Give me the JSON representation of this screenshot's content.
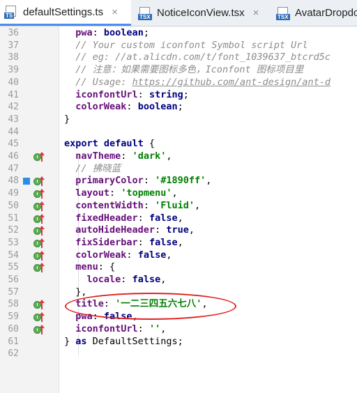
{
  "tabs": [
    {
      "badge": "TS",
      "label": "defaultSettings.ts",
      "active": true
    },
    {
      "badge": "TSX",
      "label": "NoticeIconView.tsx",
      "active": false
    },
    {
      "badge": "TSX",
      "label": "AvatarDropdo",
      "active": false
    }
  ],
  "close_glyph": "×",
  "lines": [
    {
      "n": "36",
      "tokens": [
        {
          "t": "  "
        },
        {
          "t": "pwa",
          "c": "prop"
        },
        {
          "t": ": "
        },
        {
          "t": "boolean",
          "c": "kw"
        },
        {
          "t": ";"
        }
      ]
    },
    {
      "n": "37",
      "tokens": [
        {
          "t": "  // Your custom iconfont Symbol script Url",
          "c": "cmt"
        }
      ]
    },
    {
      "n": "38",
      "tokens": [
        {
          "t": "  // eg: //at.alicdn.com/t/font_1039637_btcrd5c",
          "c": "cmt"
        }
      ]
    },
    {
      "n": "39",
      "tokens": [
        {
          "t": "  // 注意：如果需要图标多色，Iconfont 图标项目里",
          "c": "cmt"
        }
      ]
    },
    {
      "n": "40",
      "tokens": [
        {
          "t": "  // Usage: ",
          "c": "cmt"
        },
        {
          "t": "https://github.com/ant-design/ant-d",
          "c": "cmt link"
        }
      ]
    },
    {
      "n": "41",
      "tokens": [
        {
          "t": "  "
        },
        {
          "t": "iconfontUrl",
          "c": "prop"
        },
        {
          "t": ": "
        },
        {
          "t": "string",
          "c": "kw"
        },
        {
          "t": ";"
        }
      ]
    },
    {
      "n": "42",
      "tokens": [
        {
          "t": "  "
        },
        {
          "t": "colorWeak",
          "c": "prop"
        },
        {
          "t": ": "
        },
        {
          "t": "boolean",
          "c": "kw"
        },
        {
          "t": ";"
        }
      ]
    },
    {
      "n": "43",
      "tokens": [
        {
          "t": "}"
        }
      ]
    },
    {
      "n": "44",
      "tokens": []
    },
    {
      "n": "45",
      "tokens": [
        {
          "t": "export default",
          "c": "kw"
        },
        {
          "t": " {"
        }
      ]
    },
    {
      "n": "46",
      "tokens": [
        {
          "t": "  "
        },
        {
          "t": "navTheme",
          "c": "prop"
        },
        {
          "t": ": "
        },
        {
          "t": "'dark'",
          "c": "str"
        },
        {
          "t": ","
        }
      ],
      "marker": true
    },
    {
      "n": "47",
      "tokens": [
        {
          "t": "  // 拂晓蓝",
          "c": "cmt"
        }
      ]
    },
    {
      "n": "48",
      "tokens": [
        {
          "t": "  "
        },
        {
          "t": "primaryColor",
          "c": "prop"
        },
        {
          "t": ": "
        },
        {
          "t": "'#1890ff'",
          "c": "str"
        },
        {
          "t": ","
        }
      ],
      "marker": true,
      "swatch": "#2b8de8"
    },
    {
      "n": "49",
      "tokens": [
        {
          "t": "  "
        },
        {
          "t": "layout",
          "c": "prop"
        },
        {
          "t": ": "
        },
        {
          "t": "'topmenu'",
          "c": "str"
        },
        {
          "t": ","
        }
      ],
      "marker": true
    },
    {
      "n": "50",
      "tokens": [
        {
          "t": "  "
        },
        {
          "t": "contentWidth",
          "c": "prop"
        },
        {
          "t": ": "
        },
        {
          "t": "'Fluid'",
          "c": "str"
        },
        {
          "t": ","
        }
      ],
      "marker": true
    },
    {
      "n": "51",
      "tokens": [
        {
          "t": "  "
        },
        {
          "t": "fixedHeader",
          "c": "prop"
        },
        {
          "t": ": "
        },
        {
          "t": "false",
          "c": "kw"
        },
        {
          "t": ","
        }
      ],
      "marker": true
    },
    {
      "n": "52",
      "tokens": [
        {
          "t": "  "
        },
        {
          "t": "autoHideHeader",
          "c": "prop"
        },
        {
          "t": ": "
        },
        {
          "t": "true",
          "c": "kw"
        },
        {
          "t": ","
        }
      ],
      "marker": true
    },
    {
      "n": "53",
      "tokens": [
        {
          "t": "  "
        },
        {
          "t": "fixSiderbar",
          "c": "prop"
        },
        {
          "t": ": "
        },
        {
          "t": "false",
          "c": "kw"
        },
        {
          "t": ","
        }
      ],
      "marker": true
    },
    {
      "n": "54",
      "tokens": [
        {
          "t": "  "
        },
        {
          "t": "colorWeak",
          "c": "prop"
        },
        {
          "t": ": "
        },
        {
          "t": "false",
          "c": "kw"
        },
        {
          "t": ","
        }
      ],
      "marker": true
    },
    {
      "n": "55",
      "tokens": [
        {
          "t": "  "
        },
        {
          "t": "menu",
          "c": "prop"
        },
        {
          "t": ": {"
        }
      ],
      "marker": true
    },
    {
      "n": "56",
      "tokens": [
        {
          "t": "    "
        },
        {
          "t": "locale",
          "c": "prop"
        },
        {
          "t": ": "
        },
        {
          "t": "false",
          "c": "kw"
        },
        {
          "t": ","
        }
      ]
    },
    {
      "n": "57",
      "tokens": [
        {
          "t": "  },"
        }
      ]
    },
    {
      "n": "58",
      "tokens": [
        {
          "t": "  "
        },
        {
          "t": "title",
          "c": "prop"
        },
        {
          "t": ": "
        },
        {
          "t": "'一二三四五六七八'",
          "c": "str"
        },
        {
          "t": ","
        }
      ],
      "marker": true
    },
    {
      "n": "59",
      "tokens": [
        {
          "t": "  "
        },
        {
          "t": "pwa",
          "c": "prop"
        },
        {
          "t": ": "
        },
        {
          "t": "false",
          "c": "kw"
        },
        {
          "t": ","
        }
      ],
      "marker": true
    },
    {
      "n": "60",
      "tokens": [
        {
          "t": "  "
        },
        {
          "t": "iconfontUrl",
          "c": "prop"
        },
        {
          "t": ": "
        },
        {
          "t": "''",
          "c": "str"
        },
        {
          "t": ","
        }
      ],
      "marker": true
    },
    {
      "n": "61",
      "tokens": [
        {
          "t": "} "
        },
        {
          "t": "as",
          "c": "kw"
        },
        {
          "t": " DefaultSettings;"
        }
      ]
    },
    {
      "n": "62",
      "tokens": []
    }
  ],
  "colors": {
    "keyword": "#000080",
    "property": "#660e7a",
    "string": "#008000",
    "comment": "#8c8c8c",
    "annotation": "#e02020",
    "tab_accent": "#4a8ef0"
  },
  "icons": [
    "ts-file-icon",
    "tsx-file-icon",
    "close-icon",
    "implemented-marker-icon",
    "override-arrow-icon",
    "color-swatch-icon"
  ]
}
